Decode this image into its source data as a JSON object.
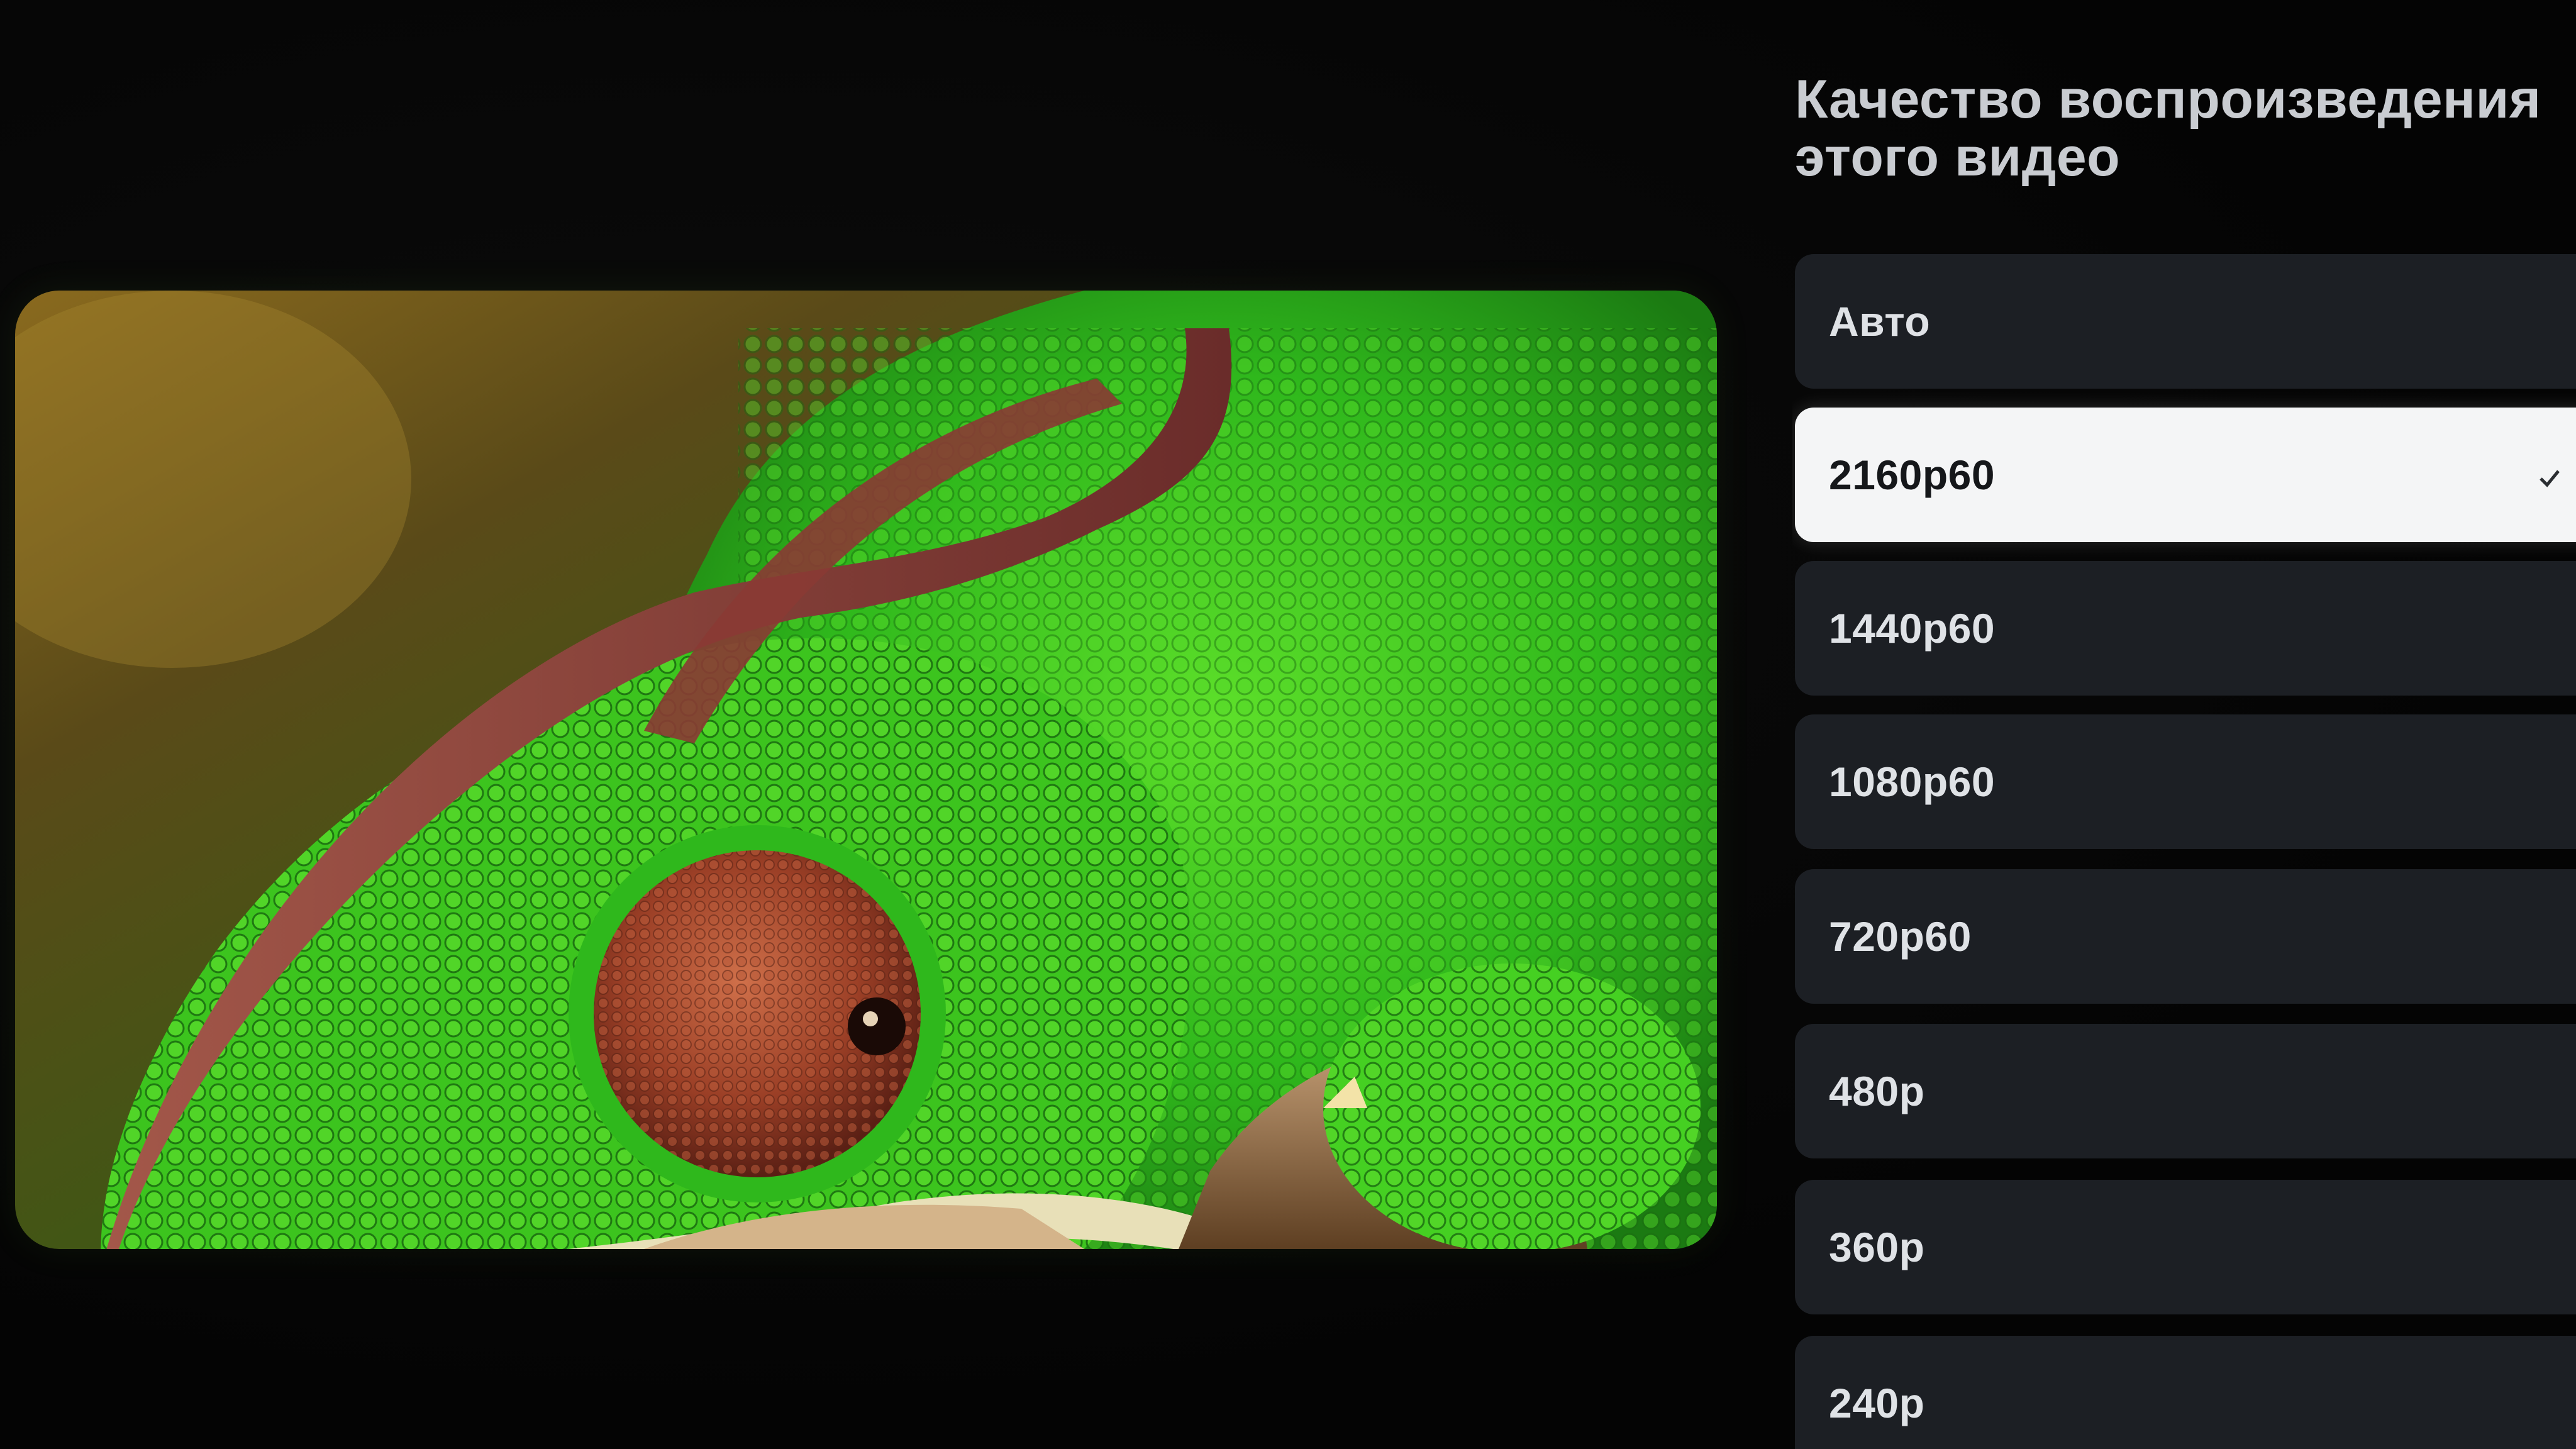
{
  "panel": {
    "title": "Качество воспроизведения этого видео",
    "selected_index": 1,
    "options": [
      {
        "label": "Авто"
      },
      {
        "label": "2160p60"
      },
      {
        "label": "1440p60"
      },
      {
        "label": "1080p60"
      },
      {
        "label": "720p60"
      },
      {
        "label": "480p"
      },
      {
        "label": "360p"
      },
      {
        "label": "240p"
      }
    ]
  },
  "colors": {
    "background": "#040404",
    "option_bg": "#1c1f24",
    "option_selected_bg": "#f4f5f6",
    "option_text": "#dfe2e6",
    "title_text": "#c9ccd1"
  },
  "icons": {
    "selected_indicator": "check-icon"
  }
}
